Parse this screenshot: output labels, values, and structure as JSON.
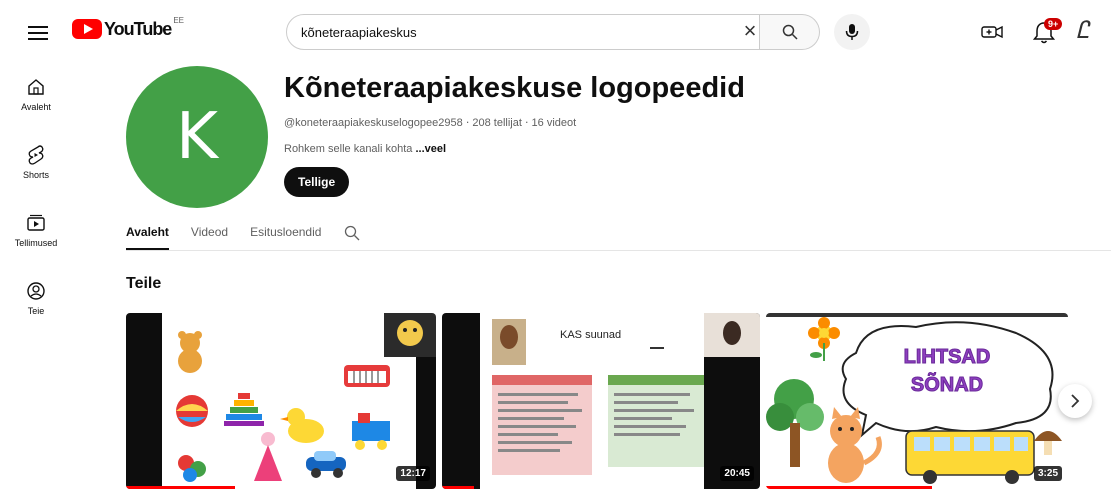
{
  "header": {
    "logo_text": "YouTube",
    "region": "EE",
    "search_value": "kõneteraapiakeskus",
    "notification_count": "9+"
  },
  "sidebar": {
    "items": [
      {
        "label": "Avaleht",
        "icon": "home-icon"
      },
      {
        "label": "Shorts",
        "icon": "shorts-icon"
      },
      {
        "label": "Tellimused",
        "icon": "subscriptions-icon"
      },
      {
        "label": "Teie",
        "icon": "you-icon"
      }
    ]
  },
  "channel": {
    "avatar_letter": "K",
    "avatar_color": "#43a047",
    "name": "Kõneteraapiakeskuse logopeedid",
    "handle": "@koneteraapiakeskuselogopee2958",
    "subscribers": "208 tellijat",
    "video_count": "16 videot",
    "meta_separator": "‧",
    "description": "Rohkem selle kanali kohta",
    "description_more": "...veel",
    "subscribe_label": "Tellige"
  },
  "tabs": [
    {
      "label": "Avaleht",
      "active": true
    },
    {
      "label": "Videod",
      "active": false
    },
    {
      "label": "Esitusloendid",
      "active": false
    }
  ],
  "section": {
    "title": "Teile"
  },
  "videos": [
    {
      "duration": "12:17",
      "progress_pct": 35
    },
    {
      "duration": "20:45",
      "progress_pct": 10,
      "slide_title": "KAS suunad"
    },
    {
      "duration": "3:25",
      "progress_pct": 55,
      "slide_text_line1": "LIHTSAD",
      "slide_text_line2": "SÕNAD"
    }
  ],
  "colors": {
    "accent_red": "#ff0000",
    "text_primary": "#0f0f0f",
    "text_secondary": "#606060"
  }
}
